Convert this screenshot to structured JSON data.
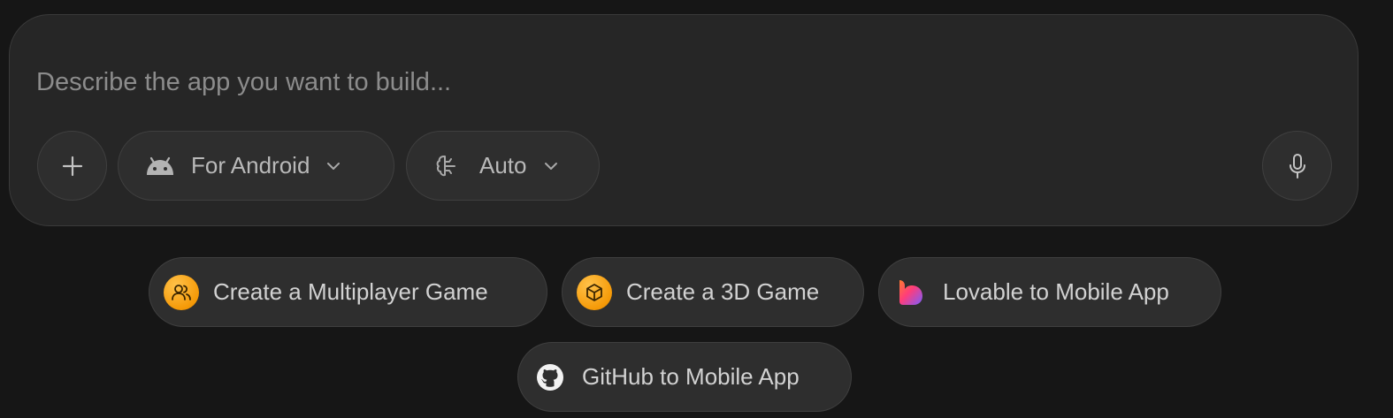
{
  "composer": {
    "placeholder": "Describe the app you want to build..."
  },
  "toolbar": {
    "platform_label": "For Android",
    "model_label": "Auto"
  },
  "suggestions": [
    {
      "label": "Create a Multiplayer Game",
      "icon": "users-icon"
    },
    {
      "label": "Create a 3D Game",
      "icon": "cube-icon"
    },
    {
      "label": "Lovable to Mobile App",
      "icon": "lovable-heart-icon"
    },
    {
      "label": "GitHub to Mobile App",
      "icon": "github-icon"
    }
  ],
  "colors": {
    "background": "#161616",
    "panel": "#262626",
    "pill": "#2e2e2e",
    "accent_orange": "#f59a08"
  }
}
